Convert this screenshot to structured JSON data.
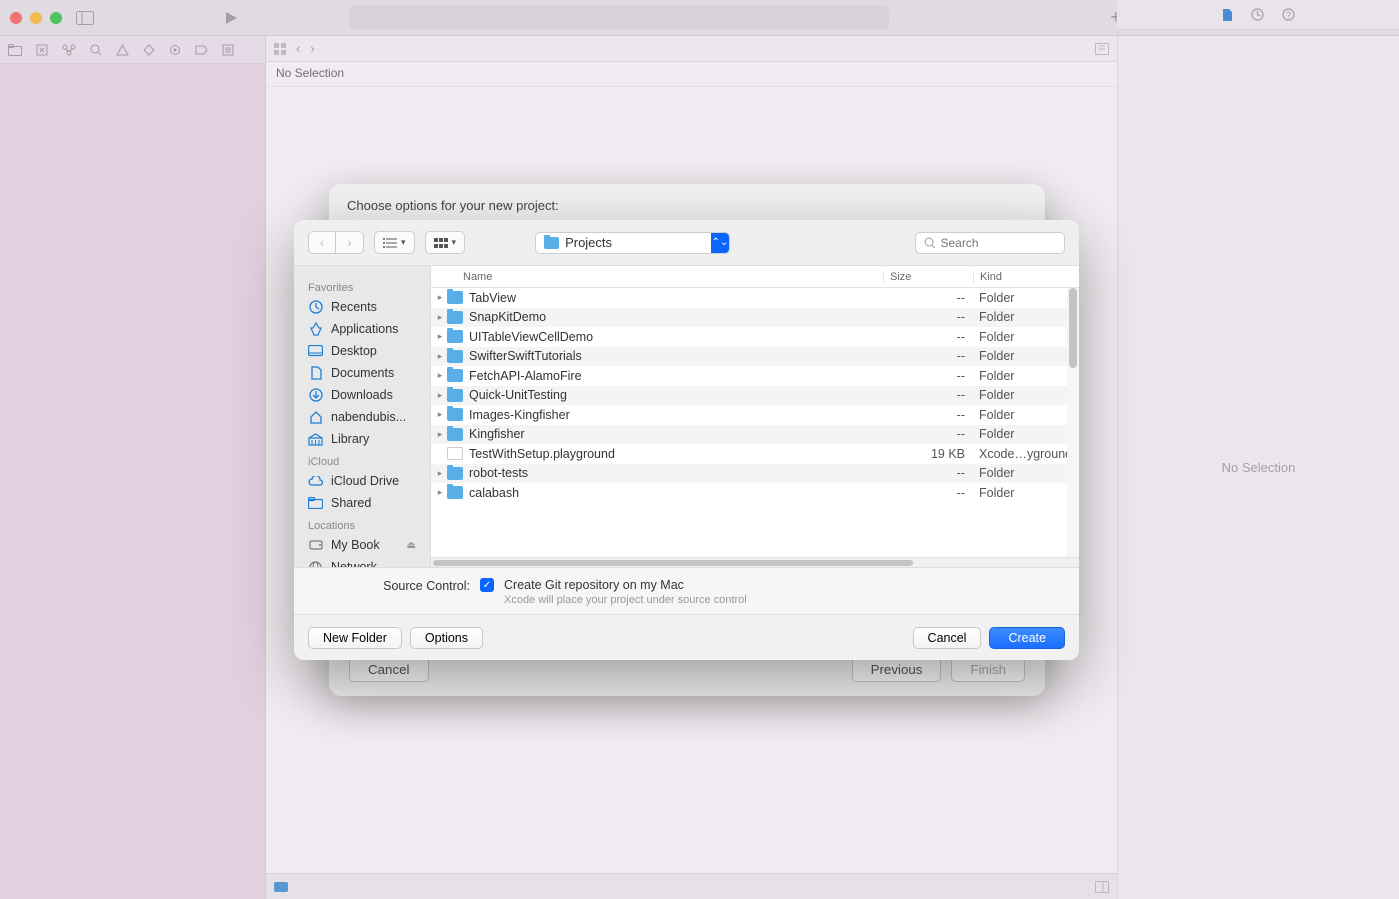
{
  "back_wizard": {
    "title": "Choose options for your new project:",
    "cancel": "Cancel",
    "previous": "Previous",
    "finish": "Finish"
  },
  "no_selection_bar": "No Selection",
  "right_panel_text": "No Selection",
  "dialog": {
    "location": "Projects",
    "search_placeholder": "Search",
    "columns": {
      "name": "Name",
      "size": "Size",
      "kind": "Kind"
    },
    "sidebar": {
      "favorites_hdr": "Favorites",
      "favorites": [
        {
          "icon": "clock",
          "label": "Recents"
        },
        {
          "icon": "apps",
          "label": "Applications"
        },
        {
          "icon": "desktop",
          "label": "Desktop"
        },
        {
          "icon": "doc",
          "label": "Documents"
        },
        {
          "icon": "download",
          "label": "Downloads"
        },
        {
          "icon": "home",
          "label": "nabendubis..."
        },
        {
          "icon": "library",
          "label": "Library"
        }
      ],
      "icloud_hdr": "iCloud",
      "icloud": [
        {
          "icon": "cloud",
          "label": "iCloud Drive"
        },
        {
          "icon": "shared",
          "label": "Shared"
        }
      ],
      "locations_hdr": "Locations",
      "locations": [
        {
          "icon": "disk",
          "label": "My Book",
          "eject": true
        },
        {
          "icon": "globe",
          "label": "Network"
        }
      ]
    },
    "files": [
      {
        "name": "TabView",
        "size": "--",
        "kind": "Folder",
        "type": "folder",
        "expandable": true
      },
      {
        "name": "SnapKitDemo",
        "size": "--",
        "kind": "Folder",
        "type": "folder",
        "expandable": true
      },
      {
        "name": "UITableViewCellDemo",
        "size": "--",
        "kind": "Folder",
        "type": "folder",
        "expandable": true
      },
      {
        "name": "SwifterSwiftTutorials",
        "size": "--",
        "kind": "Folder",
        "type": "folder",
        "expandable": true
      },
      {
        "name": "FetchAPI-AlamoFire",
        "size": "--",
        "kind": "Folder",
        "type": "folder",
        "expandable": true
      },
      {
        "name": "Quick-UnitTesting",
        "size": "--",
        "kind": "Folder",
        "type": "folder",
        "expandable": true
      },
      {
        "name": "Images-Kingfisher",
        "size": "--",
        "kind": "Folder",
        "type": "folder",
        "expandable": true
      },
      {
        "name": "Kingfisher",
        "size": "--",
        "kind": "Folder",
        "type": "folder",
        "expandable": true
      },
      {
        "name": "TestWithSetup.playground",
        "size": "19 KB",
        "kind": "Xcode…yground",
        "type": "file",
        "expandable": false
      },
      {
        "name": "robot-tests",
        "size": "--",
        "kind": "Folder",
        "type": "folder",
        "expandable": true
      },
      {
        "name": "calabash",
        "size": "--",
        "kind": "Folder",
        "type": "folder",
        "expandable": true
      }
    ],
    "source_control_label": "Source Control:",
    "git_checkbox_label": "Create Git repository on my Mac",
    "git_sub": "Xcode will place your project under source control",
    "new_folder": "New Folder",
    "options": "Options",
    "cancel": "Cancel",
    "create": "Create"
  }
}
